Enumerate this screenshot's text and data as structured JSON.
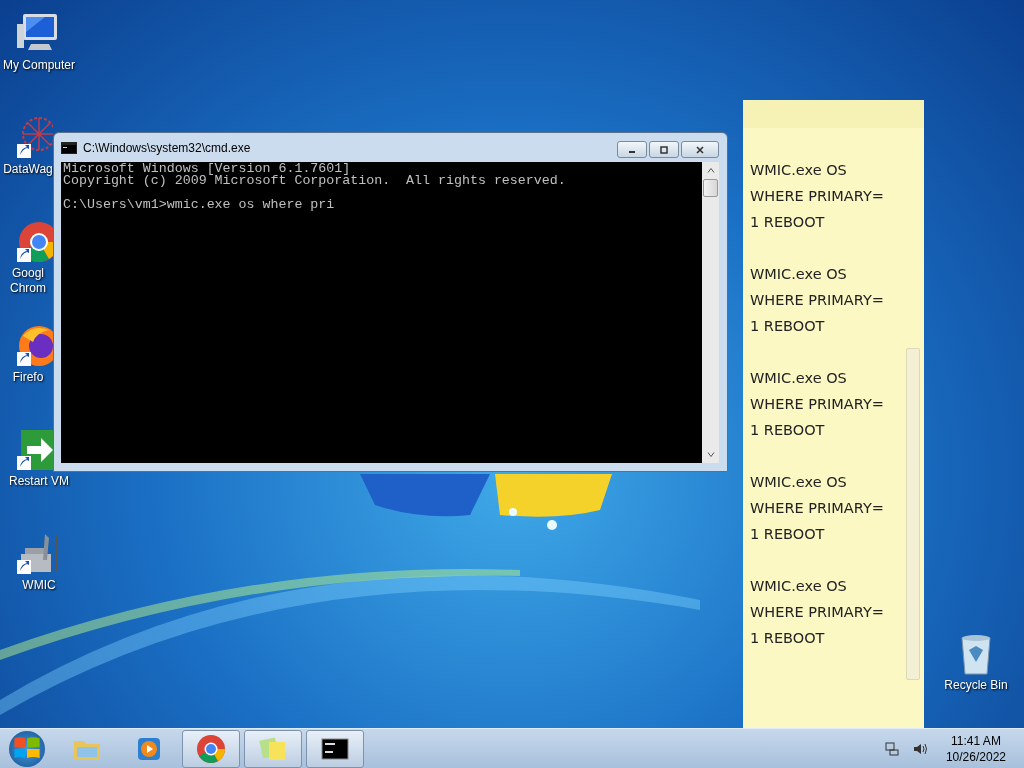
{
  "desktop_icons": [
    {
      "label": "My Computer",
      "kind": "computer",
      "shortcut": false
    },
    {
      "label": "DataWag",
      "kind": "network",
      "shortcut": true
    },
    {
      "label": "Googl Chrom",
      "kind": "chrome",
      "shortcut": true
    },
    {
      "label": "Firefo",
      "kind": "firefox",
      "shortcut": true
    },
    {
      "label": "Restart VM",
      "kind": "restart",
      "shortcut": true
    },
    {
      "label": "WMIC",
      "kind": "tools",
      "shortcut": true
    }
  ],
  "recycle_bin": {
    "label": "Recycle Bin"
  },
  "cmd_window": {
    "title": "C:\\Windows\\system32\\cmd.exe",
    "output_blocks": [
      [
        "Microsoft Windows [Version 6.1.7601]",
        "Copyright (c) 2009 Microsoft Corporation.  All rights reserved."
      ],
      [
        "C:\\Users\\vm1>wmic.exe os where pri"
      ]
    ]
  },
  "sticky_note": {
    "notes": [
      [
        "WMIC.exe OS",
        "WHERE PRIMARY=",
        "1 REBOOT"
      ],
      [
        "WMIC.exe OS",
        "WHERE PRIMARY=",
        "1 REBOOT"
      ],
      [
        "WMIC.exe OS",
        "WHERE PRIMARY=",
        "1 REBOOT"
      ],
      [
        "WMIC.exe OS",
        "WHERE PRIMARY=",
        "1 REBOOT"
      ],
      [
        "WMIC.exe OS",
        "WHERE PRIMARY=",
        "1 REBOOT"
      ]
    ]
  },
  "taskbar": {
    "buttons": [
      {
        "kind": "explorer",
        "running": false
      },
      {
        "kind": "media",
        "running": false
      },
      {
        "kind": "chrome",
        "running": true
      },
      {
        "kind": "sticky",
        "running": true
      },
      {
        "kind": "console",
        "running": true
      }
    ],
    "clock": {
      "time": "11:41 AM",
      "date": "10/26/2022"
    }
  }
}
